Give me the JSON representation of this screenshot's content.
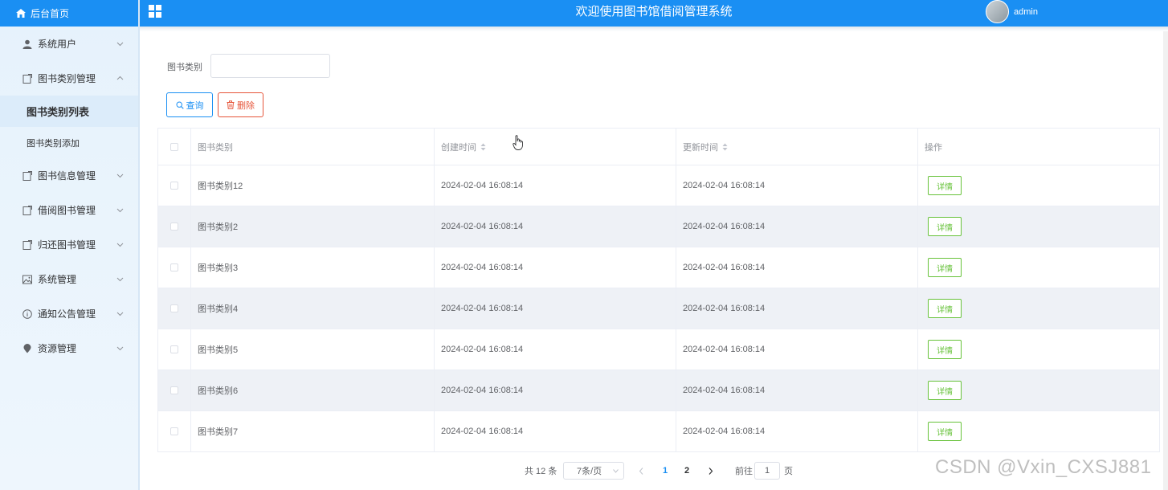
{
  "sidebar": {
    "home_label": "后台首页",
    "items": [
      {
        "label": "系统用户",
        "icon": "user-icon"
      },
      {
        "label": "图书类别管理",
        "icon": "document-icon"
      },
      {
        "label": "图书信息管理",
        "icon": "document-icon"
      },
      {
        "label": "借阅图书管理",
        "icon": "document-icon"
      },
      {
        "label": "归还图书管理",
        "icon": "document-icon"
      },
      {
        "label": "系统管理",
        "icon": "picture-icon"
      },
      {
        "label": "通知公告管理",
        "icon": "info-icon"
      },
      {
        "label": "资源管理",
        "icon": "location-icon"
      }
    ],
    "sub_items": [
      "图书类别列表",
      "图书类别添加"
    ]
  },
  "header": {
    "title": "欢迎使用图书馆借阅管理系统",
    "username": "admin"
  },
  "search": {
    "label": "图书类别",
    "value": "",
    "query_label": "查询",
    "delete_label": "删除"
  },
  "table": {
    "columns": [
      "图书类别",
      "创建时间",
      "更新时间",
      "操作"
    ],
    "rows": [
      {
        "category": "图书类别12",
        "created": "2024-02-04 16:08:14",
        "updated": "2024-02-04 16:08:14",
        "action": "详情"
      },
      {
        "category": "图书类别2",
        "created": "2024-02-04 16:08:14",
        "updated": "2024-02-04 16:08:14",
        "action": "详情"
      },
      {
        "category": "图书类别3",
        "created": "2024-02-04 16:08:14",
        "updated": "2024-02-04 16:08:14",
        "action": "详情"
      },
      {
        "category": "图书类别4",
        "created": "2024-02-04 16:08:14",
        "updated": "2024-02-04 16:08:14",
        "action": "详情"
      },
      {
        "category": "图书类别5",
        "created": "2024-02-04 16:08:14",
        "updated": "2024-02-04 16:08:14",
        "action": "详情"
      },
      {
        "category": "图书类别6",
        "created": "2024-02-04 16:08:14",
        "updated": "2024-02-04 16:08:14",
        "action": "详情"
      },
      {
        "category": "图书类别7",
        "created": "2024-02-04 16:08:14",
        "updated": "2024-02-04 16:08:14",
        "action": "详情"
      }
    ]
  },
  "pagination": {
    "total": "共 12 条",
    "page_size": "7条/页",
    "pages": [
      "1",
      "2"
    ],
    "current_page": "1",
    "goto_label": "前往",
    "goto_value": "1",
    "page_suffix": "页"
  },
  "colors": {
    "primary": "#1a8ff3",
    "danger": "#e6553a",
    "success": "#67c23a"
  },
  "watermark": "CSDN @Vxin_CXSJ881"
}
